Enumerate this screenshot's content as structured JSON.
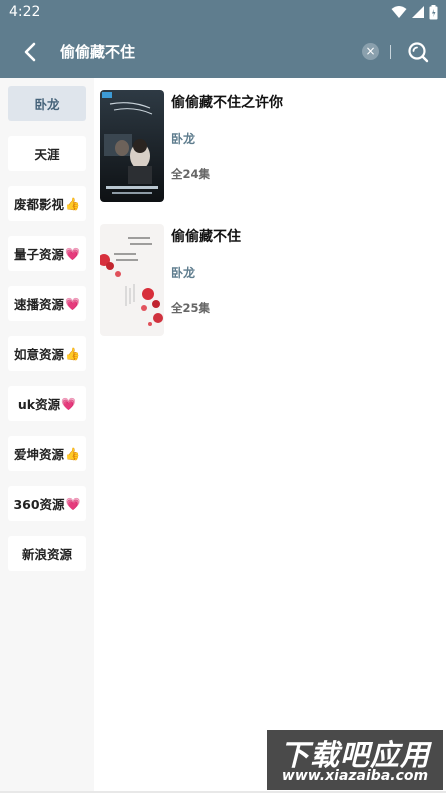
{
  "status_bar": {
    "time": "4:22"
  },
  "app_bar": {
    "search_text": "偷偷藏不住",
    "clear_icon": "×"
  },
  "sources": [
    {
      "label": "卧龙",
      "emoji": "",
      "active": true
    },
    {
      "label": "天涯",
      "emoji": ""
    },
    {
      "label": "废都影视",
      "emoji": "👍"
    },
    {
      "label": "量子资源",
      "emoji": "💗"
    },
    {
      "label": "速播资源",
      "emoji": "💗"
    },
    {
      "label": "如意资源",
      "emoji": "👍"
    },
    {
      "label": "uk资源",
      "emoji": "💗"
    },
    {
      "label": "爱坤资源",
      "emoji": "👍"
    },
    {
      "label": "360资源",
      "emoji": "💗"
    },
    {
      "label": "新浪资源",
      "emoji": ""
    }
  ],
  "results": [
    {
      "title": "偷偷藏不住之许你",
      "source": "卧龙",
      "episodes": "全24集"
    },
    {
      "title": "偷偷藏不住",
      "source": "卧龙",
      "episodes": "全25集"
    }
  ],
  "watermark": {
    "logo": "下载吧应用",
    "url": "www.xiazaiba.com"
  },
  "colors": {
    "app_bar": "#5f7d8e",
    "active_source_bg": "#dfe5ec",
    "source_text": "#5f7d8e"
  }
}
